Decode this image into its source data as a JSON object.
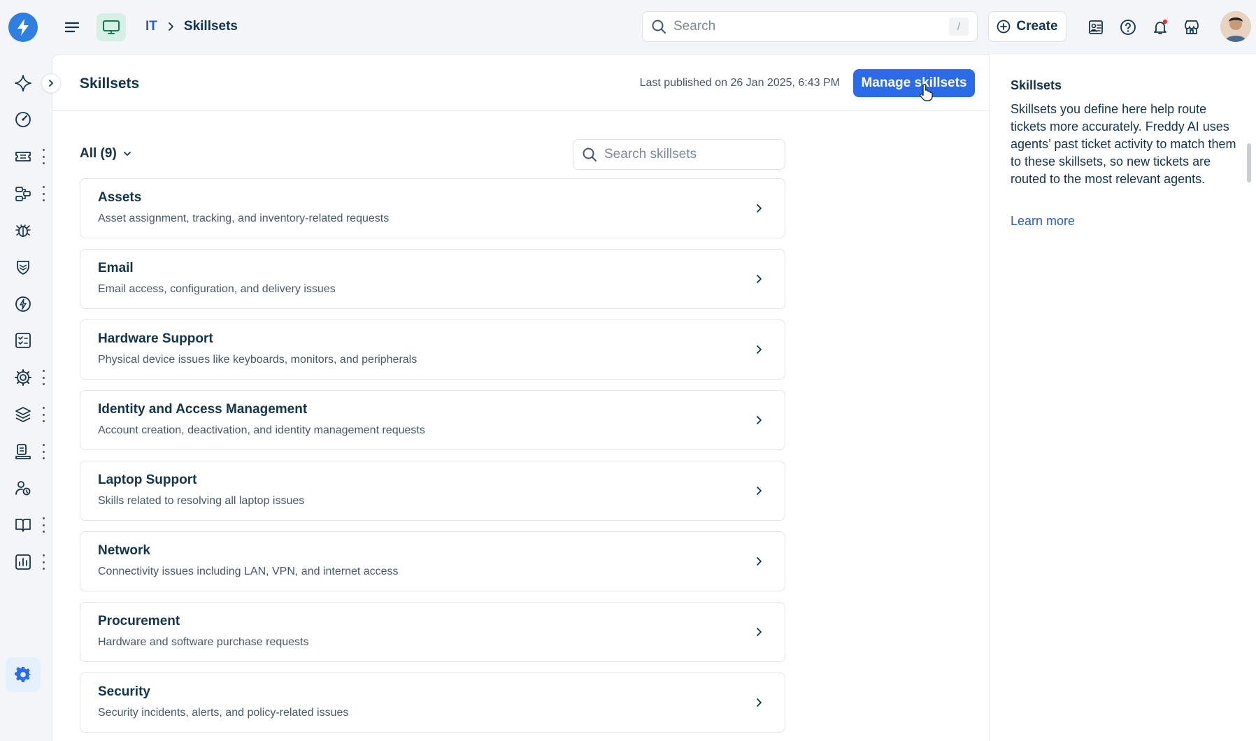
{
  "header": {
    "breadcrumb": {
      "workspace": "IT",
      "current": "Skillsets"
    },
    "search": {
      "placeholder": "Search",
      "shortcut": "/"
    },
    "create_label": "Create"
  },
  "rail": {
    "icons": [
      "freddy-sparkle-icon",
      "dashboard-icon",
      "ticket-icon",
      "workflow-icon",
      "bug-icon",
      "shield-icon",
      "change-icon",
      "tasks-icon",
      "settings-gear-icon",
      "layers-icon",
      "service-desk-icon",
      "people-icon",
      "book-icon",
      "reports-icon",
      "admin-gear-icon"
    ]
  },
  "main": {
    "title": "Skillsets",
    "last_published": "Last published on 26 Jan 2025, 6:43 PM",
    "manage_label": "Manage skillsets",
    "filter_label": "All (9)",
    "search_placeholder": "Search skillsets",
    "skills": [
      {
        "name": "Assets",
        "desc": "Asset assignment, tracking, and inventory-related requests"
      },
      {
        "name": "Email",
        "desc": "Email access, configuration, and delivery issues"
      },
      {
        "name": "Hardware Support",
        "desc": "Physical device issues like keyboards, monitors, and peripherals"
      },
      {
        "name": "Identity and Access Management",
        "desc": "Account creation, deactivation, and identity management requests"
      },
      {
        "name": "Laptop Support",
        "desc": "Skills related to resolving all laptop issues"
      },
      {
        "name": "Network",
        "desc": "Connectivity issues including LAN, VPN, and internet access"
      },
      {
        "name": "Procurement",
        "desc": "Hardware and software purchase requests"
      },
      {
        "name": "Security",
        "desc": "Security incidents, alerts, and policy-related issues"
      }
    ]
  },
  "side": {
    "title": "Skillsets",
    "text": "Skillsets you define here help route tickets more accurately. Freddy AI uses agents’ past ticket activity to match them to these skillsets, so new tickets are routed to the most relevant agents.",
    "link": "Learn more"
  },
  "colors": {
    "primary": "#2c6be8",
    "link": "#2c5cc5",
    "text": "#12344d",
    "workspace_bg": "#d6f0e6",
    "notification_dot": "#e43538"
  }
}
